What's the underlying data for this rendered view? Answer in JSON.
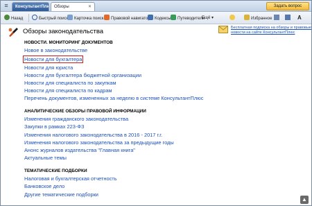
{
  "app": {
    "tab_app": "КонсультантПлюс",
    "tab_active": "Обзоры",
    "tab_close": "✕",
    "menu_glyph": "≡",
    "ask_button": "Задать вопрос"
  },
  "toolbar": {
    "back": "Назад",
    "quick_search": "Быстрый поиск",
    "card_search": "Карточка поиска",
    "legal_navigator": "Правовой навигатор",
    "codes": "Кодексы",
    "guides": "Путеводители",
    "more": "Ещё",
    "favorites": "Избранное",
    "font_glyph": "A"
  },
  "page": {
    "title": "Обзоры законодательства",
    "subscribe_link": "Бесплатная подписка на обзоры и правовые новости на сайте КонсультантПлюс"
  },
  "sections": [
    {
      "heading": "НОВОСТИ. МОНИТОРИНГ ДОКУМЕНТОВ",
      "links": [
        "Новое в законодательстве",
        "Новости для бухгалтера",
        "Новости для юриста",
        "Новости для бухгалтера бюджетной организации",
        "Новости для специалиста по закупкам",
        "Новости для специалиста по кадрам",
        "Перечень документов, измененных за неделю в системе КонсультантПлюс"
      ]
    },
    {
      "heading": "АНАЛИТИЧЕСКИЕ ОБЗОРЫ ПРАВОВОЙ ИНФОРМАЦИИ",
      "links": [
        "Изменения гражданского законодательства",
        "Закупки в рамках 223-ФЗ",
        "Изменения налогового законодательства в 2016 - 2017 г.г.",
        "Изменения налогового законодательства за предыдущие годы",
        "Анонс журналов издательства \"Главная книга\"",
        "Актуальные темы"
      ]
    },
    {
      "heading": "ТЕМАТИЧЕСКИЕ ПОДБОРКИ",
      "links": [
        "Налоговая и бухгалтерская отчетность",
        "Банковское дело",
        "Другие тематические подборки"
      ]
    }
  ],
  "colors": {
    "link": "#1a4fb8",
    "highlight": "#cc1d1d"
  }
}
